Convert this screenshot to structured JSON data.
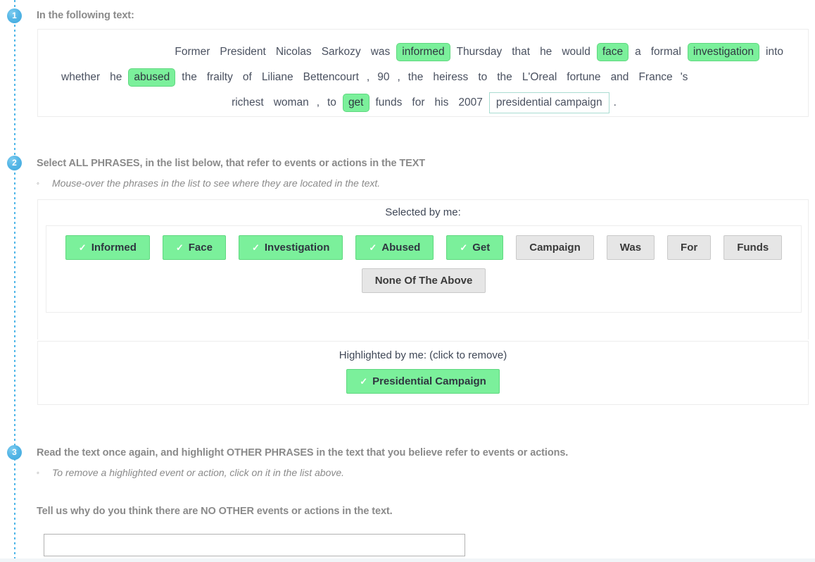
{
  "theme": {
    "accent_blue": "#4fb6e8",
    "highlight_green": "#7bf09b",
    "highlight_green_border": "#5fd87f",
    "outline_teal": "#a9ddd1",
    "grey_chip": "#e6e6e6",
    "heading_grey": "#8a8a8a",
    "text_navy": "#4a5160"
  },
  "steps": {
    "one": "1",
    "two": "2",
    "three": "3"
  },
  "step1": {
    "heading": "In the following text:",
    "passage_lines": [
      [
        {
          "t": "Former",
          "s": "plain"
        },
        {
          "t": "President",
          "s": "plain"
        },
        {
          "t": "Nicolas",
          "s": "plain"
        },
        {
          "t": "Sarkozy",
          "s": "plain"
        },
        {
          "t": "was",
          "s": "plain"
        },
        {
          "t": "informed",
          "s": "highlight"
        },
        {
          "t": "Thursday",
          "s": "plain"
        },
        {
          "t": "that",
          "s": "plain"
        },
        {
          "t": "he",
          "s": "plain"
        },
        {
          "t": "would",
          "s": "plain"
        },
        {
          "t": "face",
          "s": "highlight"
        },
        {
          "t": "a",
          "s": "plain"
        },
        {
          "t": "formal",
          "s": "plain"
        },
        {
          "t": "investigation",
          "s": "highlight"
        },
        {
          "t": "into",
          "s": "plain"
        }
      ],
      [
        {
          "t": "whether",
          "s": "plain"
        },
        {
          "t": "he",
          "s": "plain"
        },
        {
          "t": "abused",
          "s": "highlight"
        },
        {
          "t": "the",
          "s": "plain"
        },
        {
          "t": "frailty",
          "s": "plain"
        },
        {
          "t": "of",
          "s": "plain"
        },
        {
          "t": "Liliane",
          "s": "plain"
        },
        {
          "t": "Bettencourt",
          "s": "plain"
        },
        {
          "t": ",",
          "s": "thin"
        },
        {
          "t": "90",
          "s": "plain"
        },
        {
          "t": ",",
          "s": "thin"
        },
        {
          "t": "the",
          "s": "plain"
        },
        {
          "t": "heiress",
          "s": "plain"
        },
        {
          "t": "to",
          "s": "plain"
        },
        {
          "t": "the",
          "s": "plain"
        },
        {
          "t": "L'Oreal",
          "s": "plain"
        },
        {
          "t": "fortune",
          "s": "plain"
        },
        {
          "t": "and",
          "s": "plain"
        },
        {
          "t": "France",
          "s": "plain"
        },
        {
          "t": "'s",
          "s": "thin"
        }
      ],
      [
        {
          "t": "richest",
          "s": "plain"
        },
        {
          "t": "woman",
          "s": "plain"
        },
        {
          "t": ",",
          "s": "thin"
        },
        {
          "t": "to",
          "s": "plain"
        },
        {
          "t": "get",
          "s": "highlight"
        },
        {
          "t": "funds",
          "s": "plain"
        },
        {
          "t": "for",
          "s": "plain"
        },
        {
          "t": "his",
          "s": "plain"
        },
        {
          "t": "2007",
          "s": "plain"
        },
        {
          "t": "presidential  campaign",
          "s": "outline"
        },
        {
          "t": ".",
          "s": "thin"
        }
      ]
    ]
  },
  "step2": {
    "heading": "Select ALL PHRASES, in the list below, that refer to events or actions in the TEXT",
    "sub_bullet": "Mouse-over the phrases in the list to see where they are located in the text.",
    "selected_title": "Selected by me:",
    "chips_row1": [
      {
        "label": "Informed",
        "selected": true
      },
      {
        "label": "Face",
        "selected": true
      },
      {
        "label": "Investigation",
        "selected": true
      },
      {
        "label": "Abused",
        "selected": true
      },
      {
        "label": "Get",
        "selected": true
      },
      {
        "label": "Campaign",
        "selected": false
      },
      {
        "label": "Was",
        "selected": false
      },
      {
        "label": "For",
        "selected": false
      },
      {
        "label": "Funds",
        "selected": false
      }
    ],
    "chips_row2": [
      {
        "label": "None Of The Above",
        "selected": false
      }
    ],
    "highlighted_title": "Highlighted by me: (click to remove)",
    "highlighted_chips": [
      {
        "label": "Presidential Campaign",
        "selected": true
      }
    ],
    "check_glyph": "✓"
  },
  "step3": {
    "heading": "Read the text once again, and highlight OTHER PHRASES in the text that you believe refer to events or actions.",
    "sub_bullet": "To remove a highlighted event or action, click on it in the list above.",
    "why_label": "Tell us why do you think there are NO OTHER events or actions in the text.",
    "why_value": "",
    "why_placeholder": ""
  },
  "bullet_glyph": "◦"
}
